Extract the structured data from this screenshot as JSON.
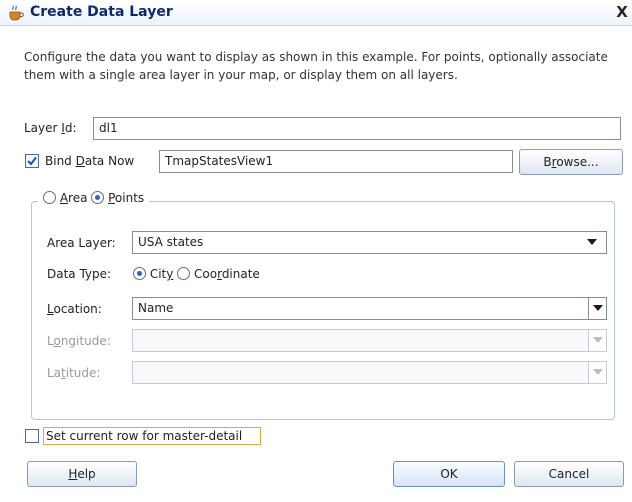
{
  "window": {
    "title": "Create Data Layer",
    "close_label": "X"
  },
  "description": "Configure the data you want to display as shown in this example. For points, optionally associate them with a single area layer in your map, or display them on all layers.",
  "layer_id": {
    "label_pre": "Layer ",
    "label_mnemonic": "I",
    "label_post": "d:",
    "value": "dl1"
  },
  "bind_data": {
    "checked": true,
    "label_pre": "Bind ",
    "label_mnemonic": "D",
    "label_post": "ata Now",
    "value": "TmapStatesView1",
    "browse_pre": "B",
    "browse_mnemonic": "r",
    "browse_post": "owse..."
  },
  "layer_type": {
    "selected": "Points",
    "area_mnemonic": "A",
    "area_rest": "rea",
    "points_mnemonic": "P",
    "points_rest": "oints"
  },
  "area_layer": {
    "label": "Area Layer:",
    "value": "USA states"
  },
  "data_type": {
    "label": "Data Type:",
    "selected": "City",
    "city_pre": "Cit",
    "city_mnemonic": "y",
    "coord_pre": "Coo",
    "coord_mnemonic": "r",
    "coord_post": "dinate"
  },
  "location": {
    "label_mnemonic": "L",
    "label_post": "ocation:",
    "value": "Name"
  },
  "longitude": {
    "label_pre": "L",
    "label_mnemonic": "o",
    "label_post": "ngitude:",
    "value": "",
    "enabled": false
  },
  "latitude": {
    "label_pre": "La",
    "label_mnemonic": "t",
    "label_post": "itude:",
    "value": "",
    "enabled": false
  },
  "master_detail": {
    "checked": false,
    "label": "Set current row for master-detail"
  },
  "buttons": {
    "help_mnemonic": "H",
    "help_post": "elp",
    "ok": "OK",
    "cancel": "Cancel"
  },
  "colors": {
    "title_text": "#0d2a6b",
    "accent": "#2d63c7",
    "focus": "#e8a640"
  }
}
